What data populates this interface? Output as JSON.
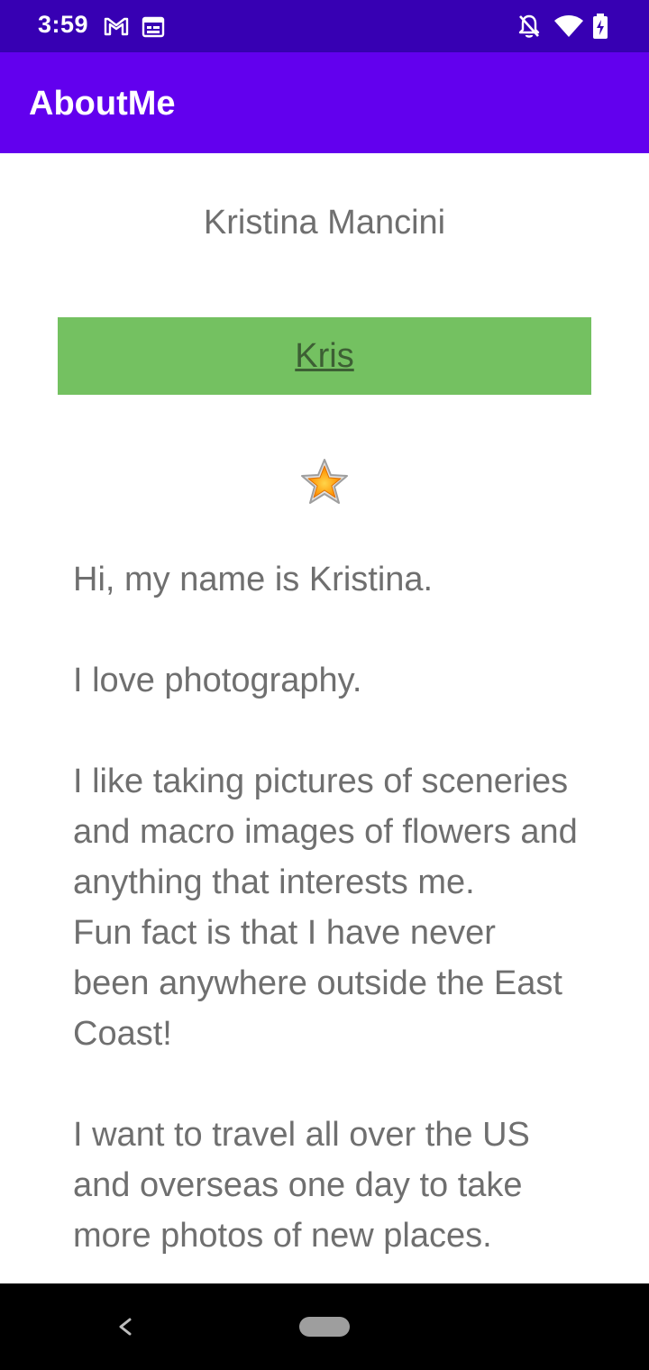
{
  "status_bar": {
    "time": "3:59",
    "icons": [
      "gmail-icon",
      "calendar-icon",
      "notifications-off-icon",
      "wifi-icon",
      "battery-charging-icon"
    ]
  },
  "app_bar": {
    "title": "AboutMe"
  },
  "profile": {
    "name": "Kristina Mancini",
    "nickname": "Kris",
    "star_icon": "star-icon",
    "bio": "Hi, my name is Kristina.\n\nI love photography.\n\nI like taking pictures of sceneries and macro images of flowers and anything that interests me.\nFun fact is that I have never been anywhere outside the East Coast!\n\nI want to travel all over the US and overseas one day to take more photos of new places."
  },
  "nav_bar": {
    "icons": [
      "back-icon",
      "home-pill-icon"
    ]
  },
  "colors": {
    "status_bar": "#3700b3",
    "app_bar": "#6200ee",
    "nickname_background": "#74c161",
    "body_text": "#6f6f6f"
  }
}
